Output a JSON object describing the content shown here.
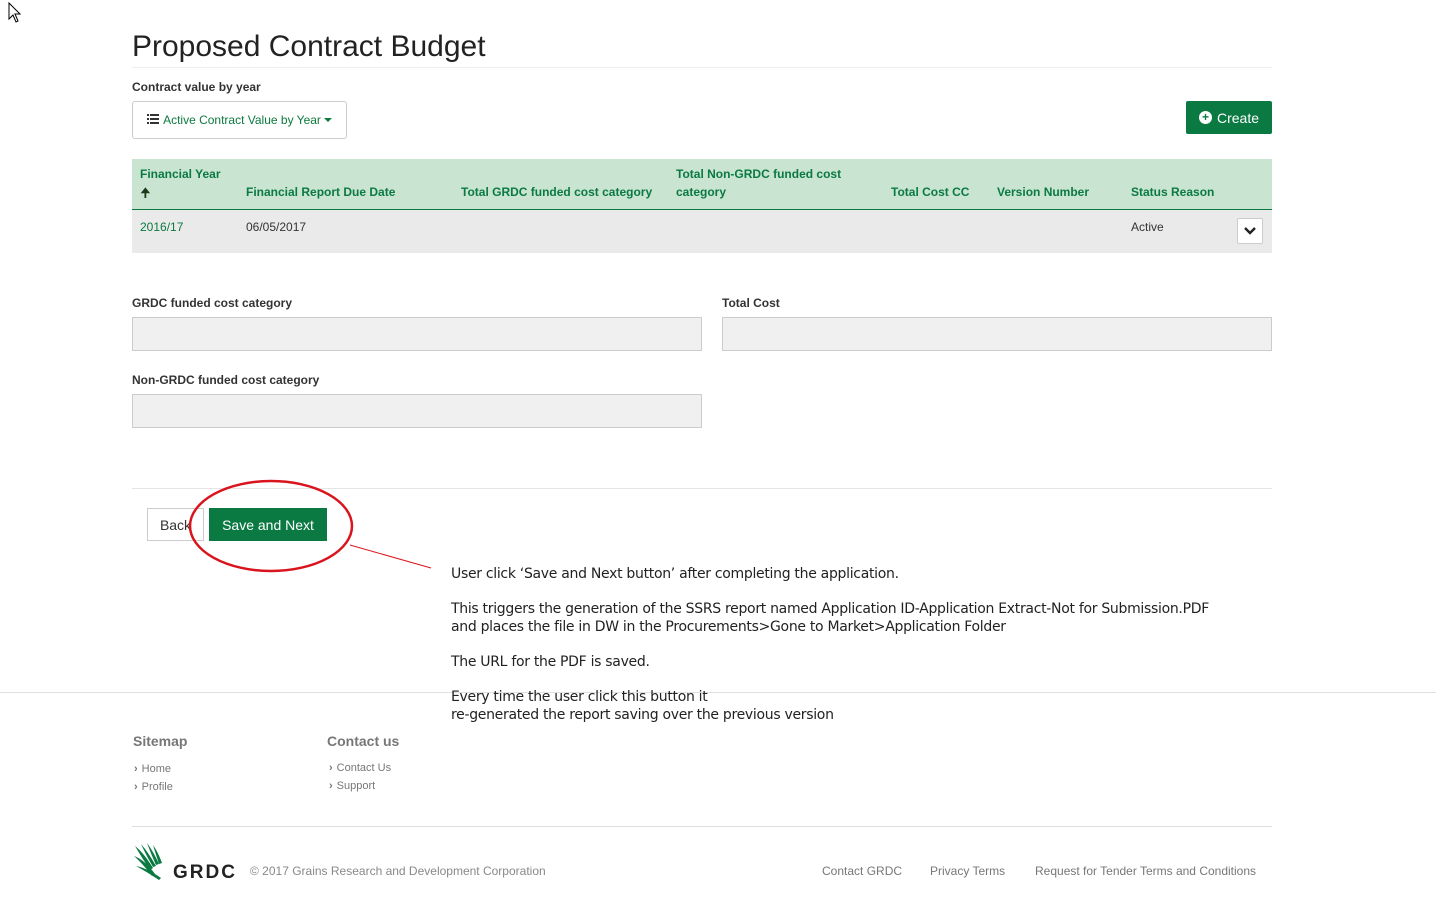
{
  "page": {
    "title": "Proposed Contract Budget",
    "subtitle": "Contract value by year"
  },
  "toolbar": {
    "view_label": "Active Contract Value by Year",
    "create_label": "Create"
  },
  "grid": {
    "columns": [
      "Financial Year",
      "Financial Report Due Date",
      "Total GRDC funded cost category",
      "Total Non-GRDC funded cost category",
      "Total Cost CC",
      "Version Number",
      "Status Reason"
    ],
    "rows": [
      {
        "financial_year": "2016/17",
        "due_date": "06/05/2017",
        "total_grdc": "",
        "total_non_grdc": "",
        "total_cost_cc": "",
        "version_number": "",
        "status_reason": "Active"
      }
    ]
  },
  "form": {
    "grdc_label": "GRDC funded cost category",
    "grdc_value": "",
    "total_cost_label": "Total Cost",
    "total_cost_value": "",
    "non_grdc_label": "Non-GRDC funded cost category",
    "non_grdc_value": ""
  },
  "actions": {
    "back_label": "Back",
    "save_next_label": "Save and Next"
  },
  "annotation": {
    "line1": "User click ‘Save and Next button’ after completing the application.",
    "line2": "This triggers the generation of the SSRS report named Application ID-Application Extract-Not for Submission.PDF",
    "line3": "and places the file in DW in the Procurements>Gone to Market>Application Folder",
    "line4": "The URL for the PDF is saved.",
    "line5": "Every time the user click this button it",
    "line6": "re-generated the report saving over the previous version",
    "circle_color": "#d9141c"
  },
  "footer": {
    "sitemap_title": "Sitemap",
    "sitemap_links": [
      "Home",
      "Profile"
    ],
    "contact_title": "Contact us",
    "contact_links": [
      "Contact Us",
      "Support"
    ],
    "logo_text": "GRDC",
    "copyright": "© 2017 Grains Research and Development Corporation",
    "bottom_links": [
      "Contact GRDC",
      "Privacy Terms",
      "Request for Tender Terms and Conditions"
    ]
  },
  "colors": {
    "brand_green": "#0a7a42",
    "header_bg": "#c9e4d1"
  }
}
